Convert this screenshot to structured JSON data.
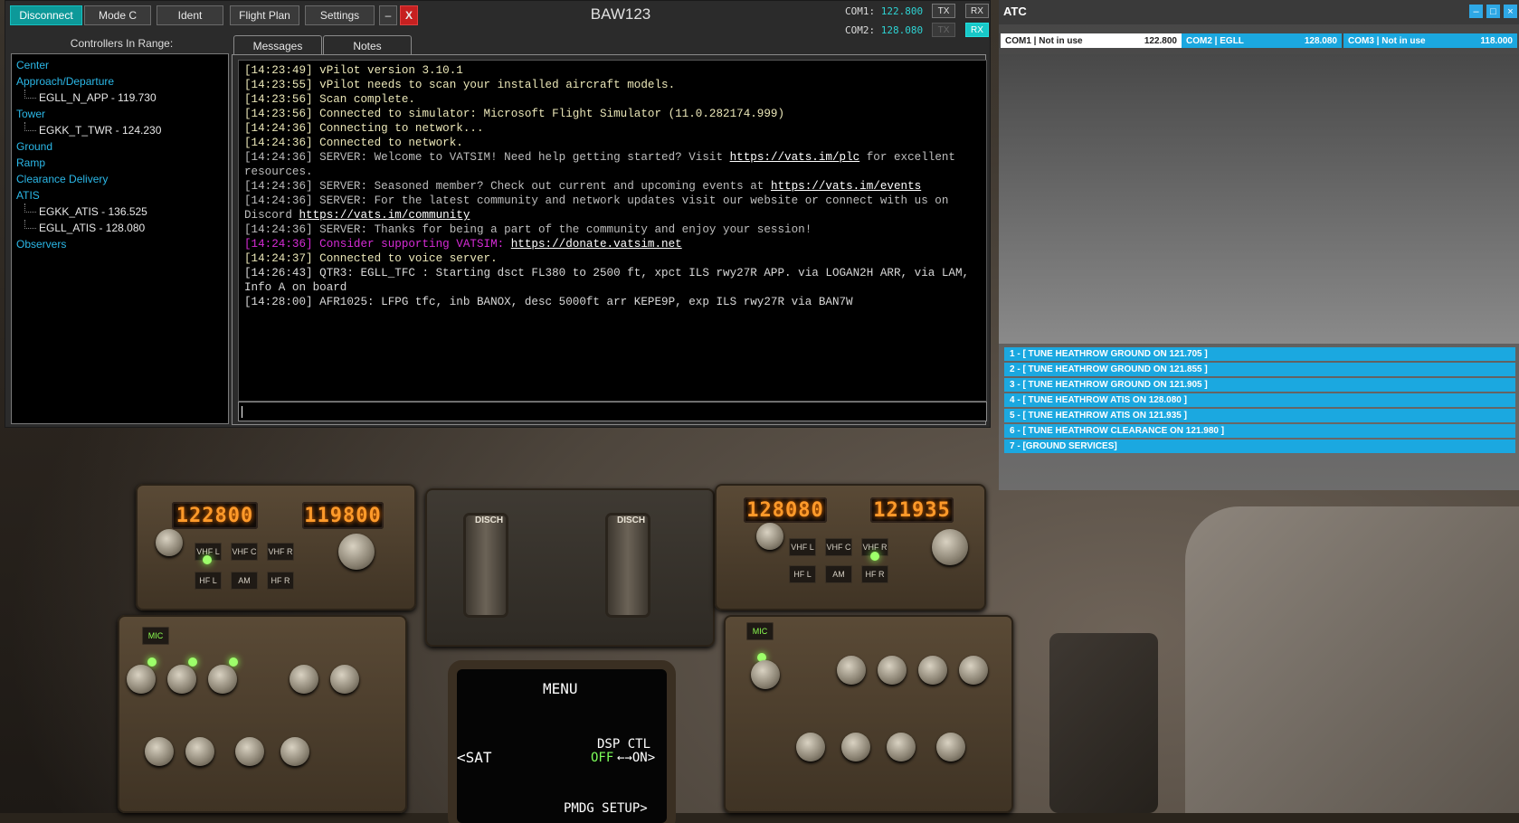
{
  "vpilot": {
    "toolbar": {
      "disconnect": "Disconnect",
      "mode_c": "Mode C",
      "ident": "Ident",
      "flight_plan": "Flight Plan",
      "settings": "Settings",
      "minimize": "–",
      "close": "X"
    },
    "callsign": "BAW123",
    "com1": {
      "label": "COM1:",
      "freq": "122.800",
      "tx": "TX",
      "rx": "RX"
    },
    "com2": {
      "label": "COM2:",
      "freq": "128.080",
      "tx": "TX",
      "rx": "RX"
    },
    "controllers_title": "Controllers In Range:",
    "controllers": {
      "center": "Center",
      "approach": "Approach/Departure",
      "approach_1": "EGLL_N_APP - 119.730",
      "tower": "Tower",
      "tower_1": "EGKK_T_TWR - 124.230",
      "ground": "Ground",
      "ramp": "Ramp",
      "clearance": "Clearance Delivery",
      "atis": "ATIS",
      "atis_1": "EGKK_ATIS - 136.525",
      "atis_2": "EGLL_ATIS - 128.080",
      "observers": "Observers"
    },
    "tabs": {
      "messages": "Messages",
      "notes": "Notes"
    },
    "messages": {
      "m1": "[14:23:49] vPilot version 3.10.1",
      "m2": "[14:23:55] vPilot needs to scan your installed aircraft models.",
      "m3": "[14:23:56] Scan complete.",
      "m4": "[14:23:56] Connected to simulator: Microsoft Flight Simulator (11.0.282174.999)",
      "m5": "[14:24:36] Connecting to network...",
      "m6": "[14:24:36] Connected to network.",
      "m7": "[14:24:36] SERVER: Welcome to VATSIM! Need help getting started? Visit ",
      "m7_link": "https://vats.im/plc",
      "m7_tail": " for excellent resources.",
      "m8": "[14:24:36] SERVER: Seasoned member? Check out current and upcoming events at ",
      "m8_link": "https://vats.im/events",
      "m9": "[14:24:36] SERVER: For the latest community and network updates visit our website or connect with us on Discord ",
      "m9_link": "https://vats.im/community",
      "m10": "[14:24:36] SERVER: Thanks for being a part of the community and enjoy your session!",
      "m11": "[14:24:36] Consider supporting VATSIM: ",
      "m11_link": "https://donate.vatsim.net",
      "m12": "[14:24:37] Connected to voice server.",
      "m13": "[14:26:43] QTR3: EGLL_TFC : Starting dsct FL380 to 2500 ft, xpct ILS rwy27R APP. via LOGAN2H ARR, via LAM, Info A on board",
      "m14": "[14:28:00] AFR1025: LFPG tfc, inb BANOX, desc 5000ft arr KEPE9P, exp ILS rwy27R via BAN7W"
    },
    "colors": {
      "accent": "#0d9999",
      "link_category": "#2bb8e8",
      "support_msg": "#d62bd6"
    }
  },
  "atc": {
    "title": "ATC",
    "com1": {
      "label": "COM1 | Not in use",
      "freq": "122.800"
    },
    "com2": {
      "label": "COM2 | EGLL",
      "freq": "128.080"
    },
    "com3": {
      "label": "COM3 | Not in use",
      "freq": "118.000"
    },
    "options": {
      "o1": "1 - [ TUNE HEATHROW GROUND ON 121.705 ]",
      "o2": "2 - [ TUNE HEATHROW GROUND ON 121.855 ]",
      "o3": "3 - [ TUNE HEATHROW GROUND ON 121.905 ]",
      "o4": "4 - [ TUNE HEATHROW ATIS ON 128.080 ]",
      "o5": "5 - [ TUNE HEATHROW ATIS ON 121.935 ]",
      "o6": "6 - [ TUNE HEATHROW CLEARANCE ON 121.980 ]",
      "o7": "7 - [GROUND SERVICES]"
    },
    "colors": {
      "option_bg": "#1ba8e0"
    }
  },
  "cockpit": {
    "left_active": "122800",
    "left_standby": "119800",
    "right_active": "128080",
    "right_standby": "121935",
    "disch": "DISCH",
    "vhf_l": "VHF L",
    "vhf_c": "VHF C",
    "vhf_r": "VHF R",
    "hf_l": "HF L",
    "am": "AM",
    "hf_r": "HF R",
    "mic": "MIC",
    "cdu_menu": "MENU",
    "cdu_sat": "<SAT",
    "cdu_dsp": "DSP CTL",
    "cdu_off": "OFF",
    "cdu_on": "←→ON>",
    "cdu_pmdg": "PMDG SETUP>"
  }
}
